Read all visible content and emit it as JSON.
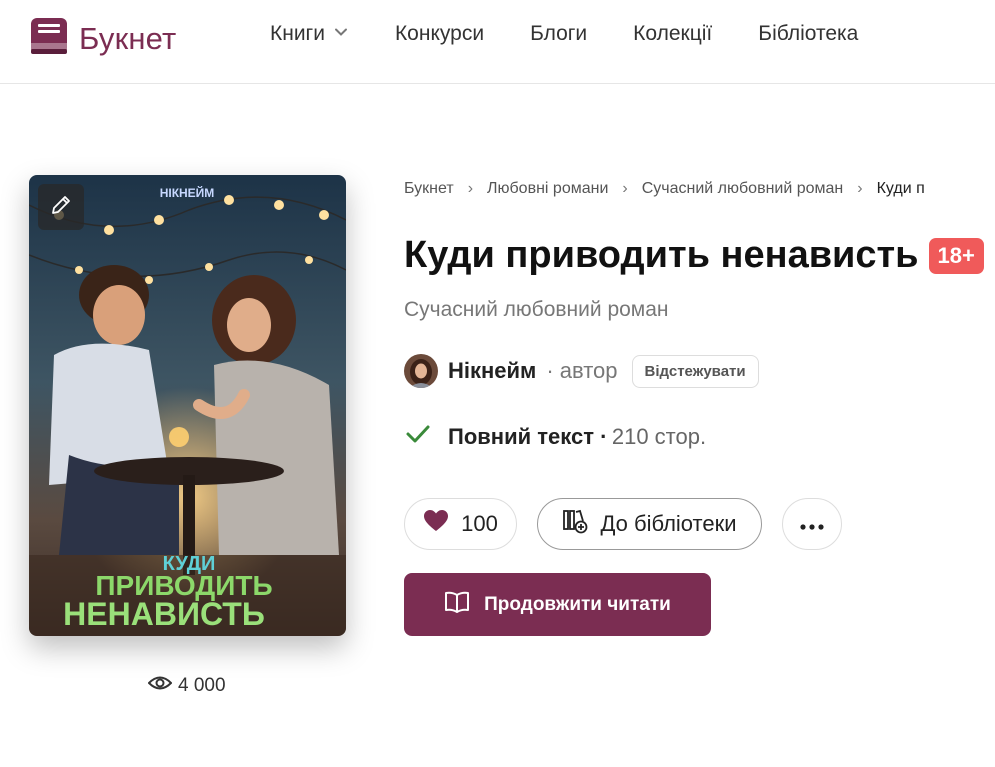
{
  "header": {
    "logo_text": "Букнет",
    "nav": [
      {
        "label": "Книги",
        "has_dropdown": true
      },
      {
        "label": "Конкурси"
      },
      {
        "label": "Блоги"
      },
      {
        "label": "Колекції"
      },
      {
        "label": "Бібліотека"
      }
    ]
  },
  "cover": {
    "author_text": "НІКНЕЙМ",
    "title_line1": "КУДИ",
    "title_line2": "ПРИВОДИТЬ",
    "title_line3": "НЕНАВИСТЬ",
    "views": "4 000"
  },
  "breadcrumb": [
    "Букнет",
    "Любовні романи",
    "Сучасний любовний роман",
    "Куди п"
  ],
  "book": {
    "title": "Куди приводить ненависть",
    "age_rating": "18+",
    "genre": "Сучасний любовний роман",
    "author_name": "Нікнейм",
    "author_role": "· автор",
    "follow_label": "Відстежувати",
    "status": "Повний текст ·",
    "pages": "210 стор."
  },
  "actions": {
    "likes": "100",
    "library_label": "До бібліотеки",
    "read_label": "Продовжити читати"
  },
  "colors": {
    "brand": "#7b2d52",
    "age_badge": "#f05a5a",
    "check": "#3a8a3a"
  }
}
